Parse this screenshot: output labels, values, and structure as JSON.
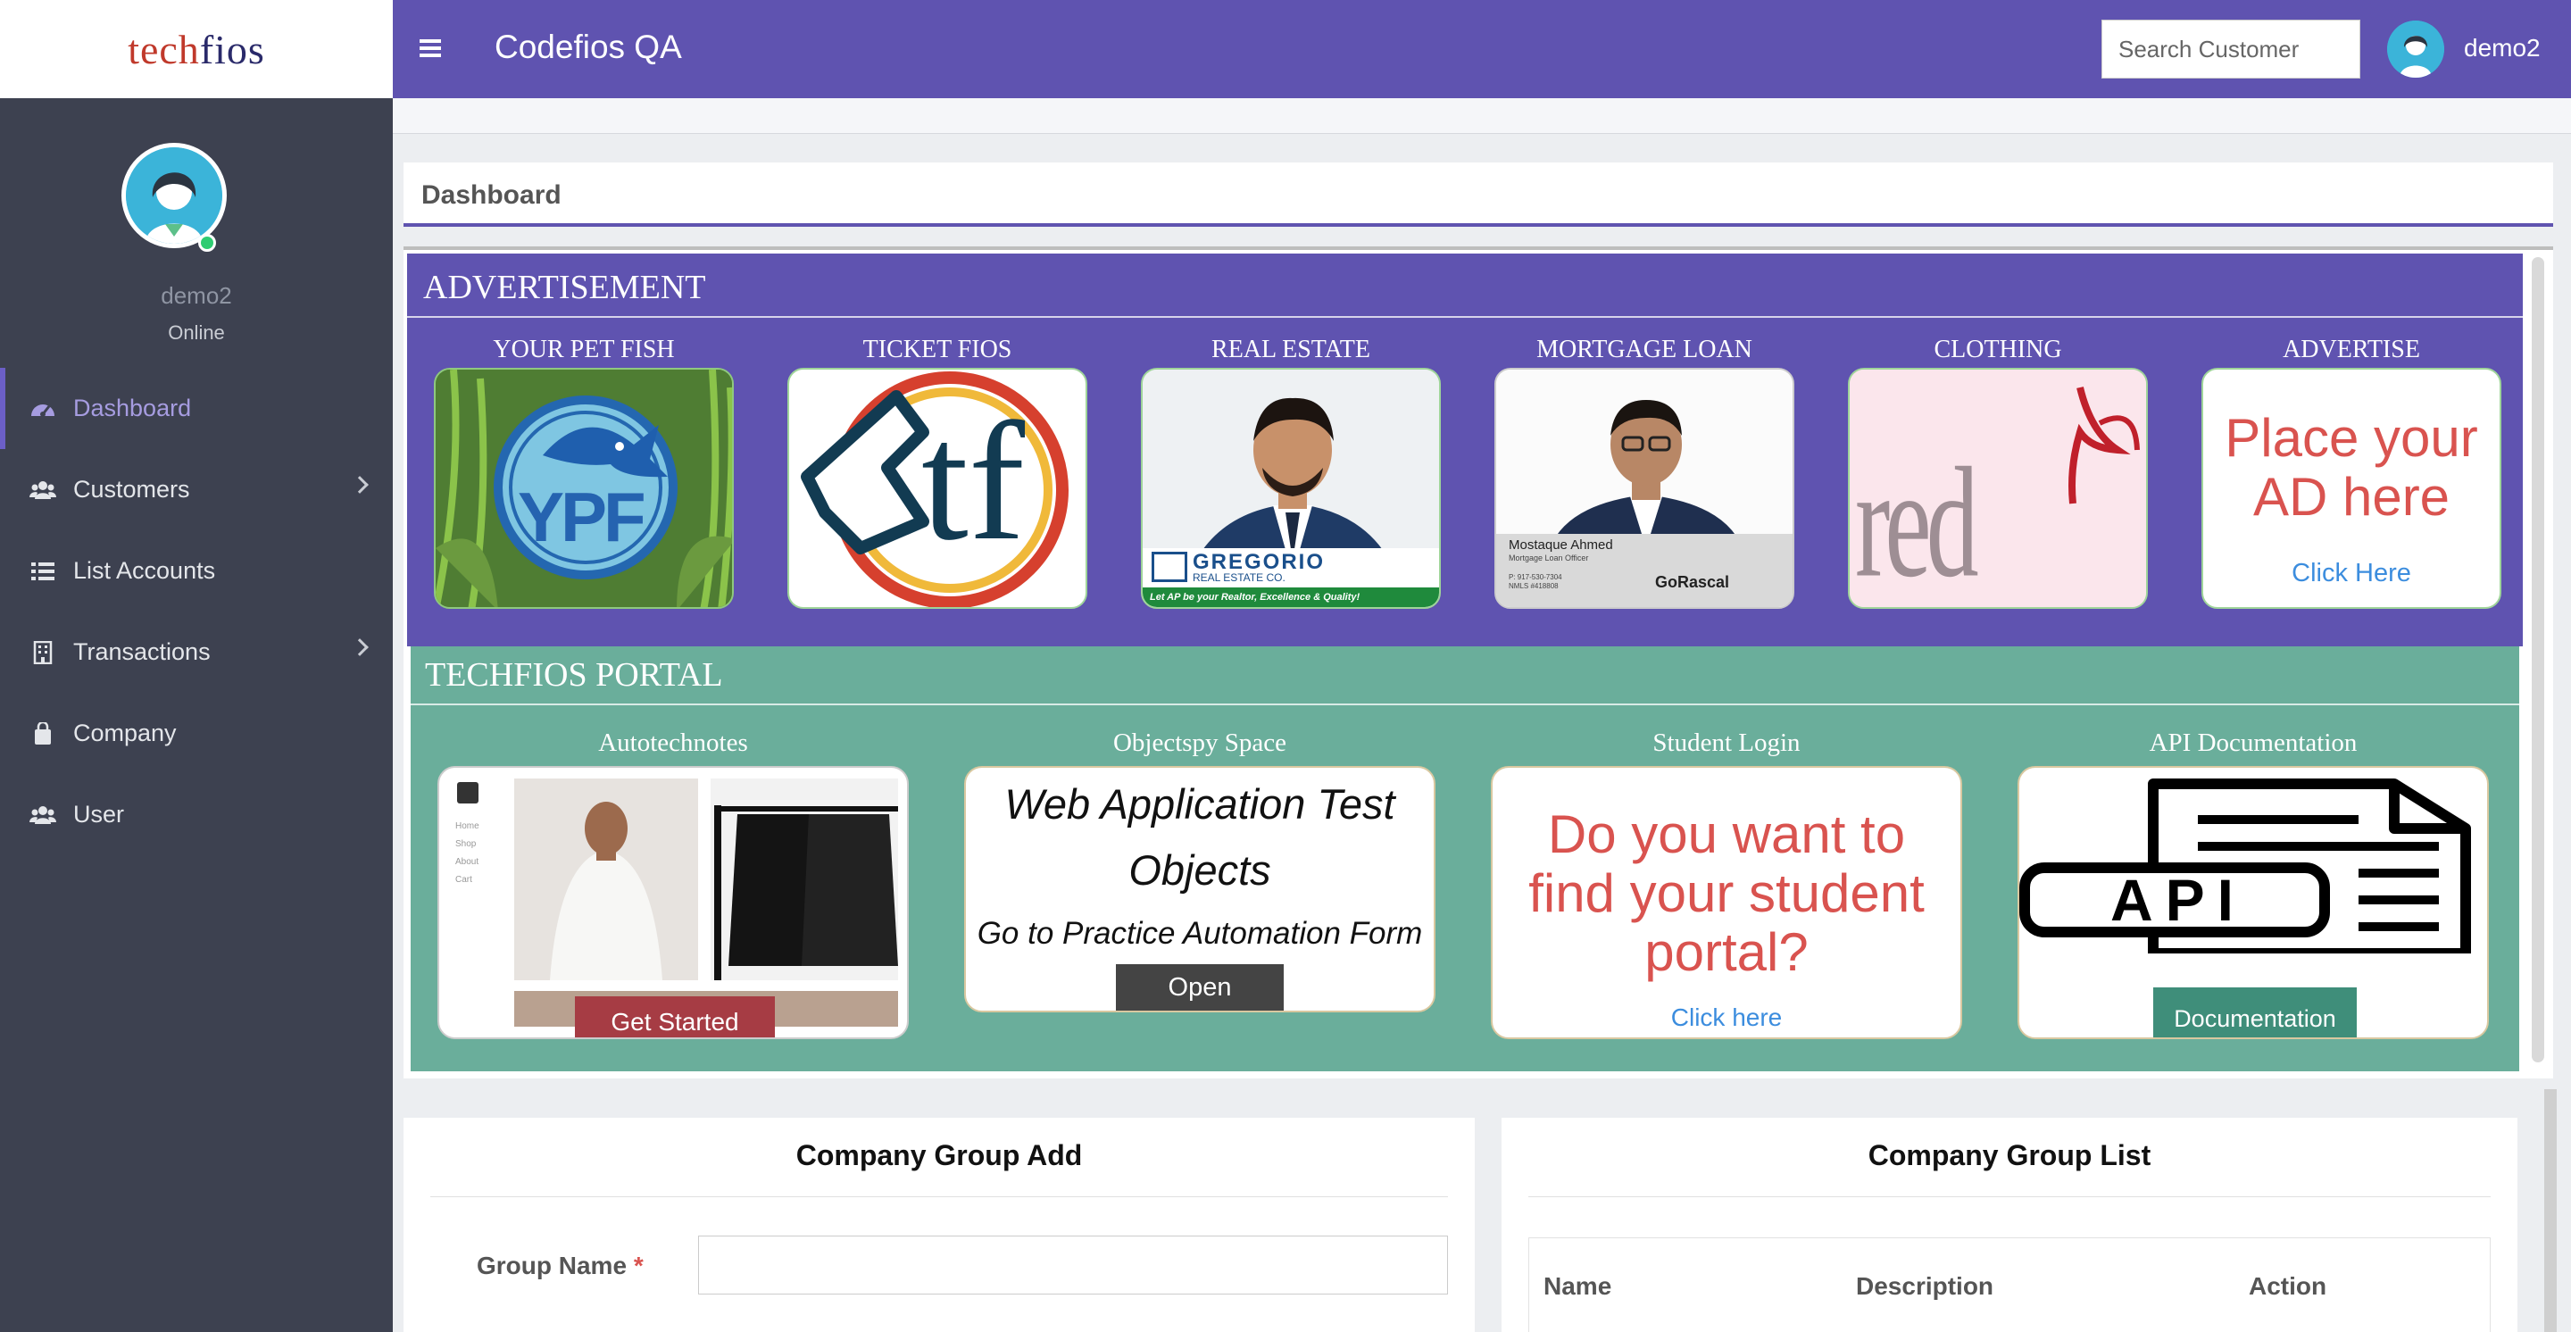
{
  "brand": {
    "part1": "tech",
    "part2": "fios"
  },
  "topbar": {
    "title": "Codefios QA",
    "search_placeholder": "Search Customer",
    "username": "demo2"
  },
  "sidebar": {
    "username": "demo2",
    "status": "Online",
    "items": [
      {
        "label": "Dashboard",
        "icon": "dashboard-icon",
        "active": true
      },
      {
        "label": "Customers",
        "icon": "users-icon",
        "submenu": true
      },
      {
        "label": "List Accounts",
        "icon": "list-icon"
      },
      {
        "label": "Transactions",
        "icon": "building-icon",
        "submenu": true
      },
      {
        "label": "Company",
        "icon": "bag-icon"
      },
      {
        "label": "User",
        "icon": "users-icon"
      }
    ]
  },
  "dashboard": {
    "title": "Dashboard"
  },
  "advertisement": {
    "title": "ADVERTISEMENT",
    "ads": [
      {
        "label": "YOUR PET FISH",
        "logo_text": "YPF"
      },
      {
        "label": "TICKET FIOS",
        "logo_text": "tf"
      },
      {
        "label": "REAL ESTATE",
        "brand": "GREGORIO",
        "brand_sub": "REAL ESTATE CO.",
        "tagline": "Let AP be your Realtor, Excellence & Quality!"
      },
      {
        "label": "MORTGAGE LOAN",
        "person": "Mostaque Ahmed",
        "role": "Mortgage Loan Officer",
        "phone": "P: 917-530-7304",
        "nmls": "NMLS #418808",
        "company": "GoRascal"
      },
      {
        "label": "CLOTHING",
        "logo_text": "red yard"
      },
      {
        "label": "ADVERTISE",
        "headline": "Place your AD here",
        "link": "Click Here"
      }
    ]
  },
  "portal": {
    "title": "TECHFIOS PORTAL",
    "cards": [
      {
        "label": "Autotechnotes",
        "button": "Get Started",
        "nav": [
          "Home",
          "Shop",
          "About",
          "Cart"
        ]
      },
      {
        "label": "Objectspy Space",
        "headline": "Web Application Test Objects",
        "sub": "Go to Practice Automation Form",
        "button": "Open"
      },
      {
        "label": "Student Login",
        "headline": "Do you want to find your student portal?",
        "link": "Click here"
      },
      {
        "label": "API Documentation",
        "logo_text": "API",
        "button": "Documentation"
      }
    ]
  },
  "company_group_add": {
    "title": "Company Group Add",
    "field_label": "Group Name",
    "required_mark": "*",
    "field_value": ""
  },
  "company_group_list": {
    "title": "Company Group List",
    "columns": [
      "Name",
      "Description",
      "Action"
    ]
  },
  "colors": {
    "primary": "#5f53b0",
    "sidebar": "#3d4150",
    "portal": "#6aae9b",
    "danger_button": "#a63c44",
    "success_button": "#3f8e7a",
    "active_menu": "#a69ce0"
  }
}
